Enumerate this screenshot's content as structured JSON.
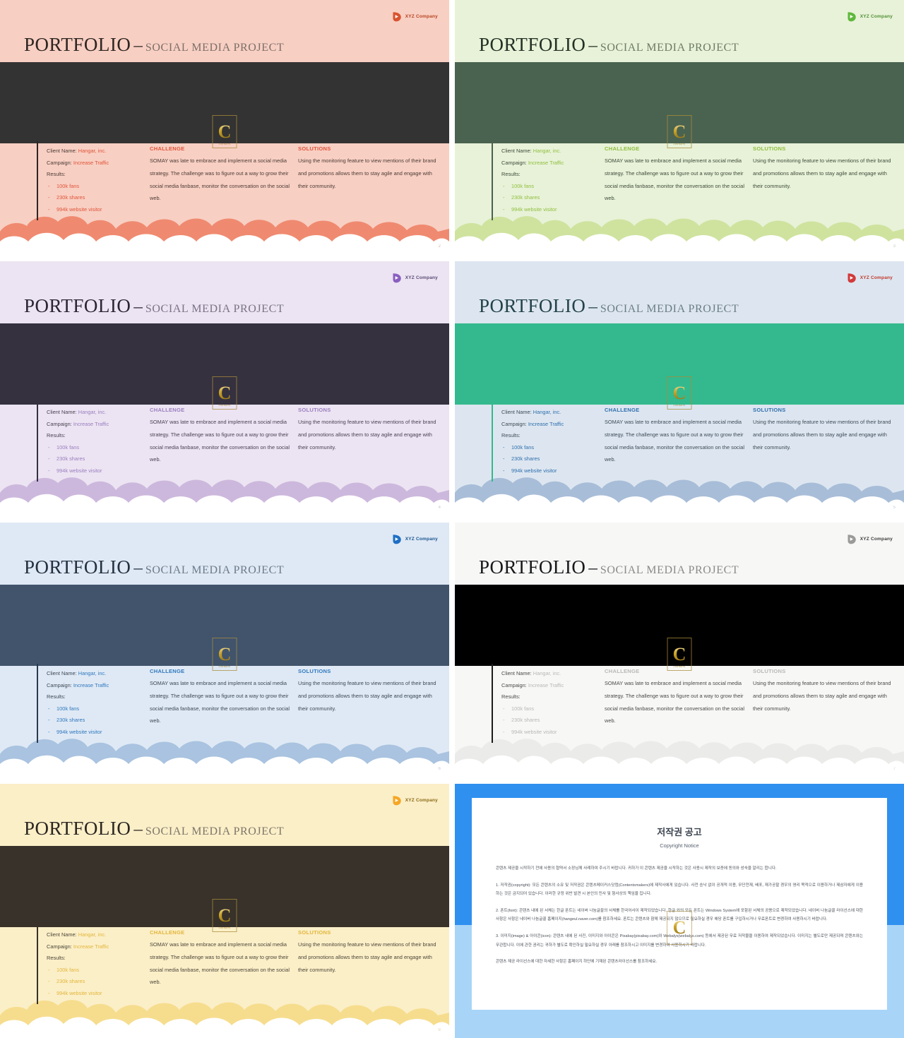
{
  "deck": {
    "title_main": "PORTFOLIO",
    "title_dash": "–",
    "title_sub": "SOCIAL MEDIA PROJECT",
    "logo_text": "XYZ Company",
    "emblem_letter": "C",
    "emblem_sub": "CONTENTS",
    "labels": {
      "client_label": "Client Name:",
      "client_value": "Hangar, inc.",
      "campaign_label": "Campaign:",
      "campaign_value": "Increase Traffic",
      "results_label": "Results:",
      "bullet_dash": "-",
      "result_1": "100k fans",
      "result_2": "230k shares",
      "result_3": "994k website visitor",
      "challenge_heading": "CHALLENGE",
      "challenge_body": "SOMAY was late to embrace and implement a social media strategy. The challenge was to figure out a way to grow their social media fanbase, monitor the conversation on the social web.",
      "solutions_heading": "SOLUTIONS",
      "solutions_body": "Using the monitoring feature to view mentions of their brand and promotions allows them to stay agile and engage with their community."
    }
  },
  "slides": [
    {
      "page": "2",
      "theme": "coral",
      "bg": "#f8cfc3",
      "band": "#333333",
      "title_color": "#2e2622",
      "sub_color": "#7d6f68",
      "logo_color": "#d8532f",
      "logo_text_color": "#b8431f",
      "accent": "#e0553a",
      "body_text": "#4b3b35",
      "bar": "#2e2622",
      "cloud_back": "#ef8a70",
      "cloud_front": "#ffffff",
      "pageno_color": "#c07a66"
    },
    {
      "page": "3",
      "theme": "green",
      "bg": "#e8f2d8",
      "band": "#4a6350",
      "title_color": "#243026",
      "sub_color": "#6f7a68",
      "logo_color": "#5fb83c",
      "logo_text_color": "#4f8f35",
      "accent": "#8fbf3f",
      "body_text": "#3e4a3c",
      "bar": "#4a6350",
      "cloud_back": "#cfe39f",
      "cloud_front": "#ffffff",
      "pageno_color": "#9aab84"
    },
    {
      "page": "4",
      "theme": "purple",
      "bg": "#ece4f2",
      "band": "#35313f",
      "title_color": "#2b2533",
      "sub_color": "#7a7385",
      "logo_color": "#8a5fc0",
      "logo_text_color": "#5b4a77",
      "accent": "#9a7ec0",
      "body_text": "#4a4255",
      "bar": "#35313f",
      "cloud_back": "#cdb8dd",
      "cloud_front": "#ffffff",
      "pageno_color": "#a294b0"
    },
    {
      "page": "5",
      "theme": "teal",
      "bg": "#dde6f0",
      "band": "#33b98d",
      "title_color": "#23424a",
      "sub_color": "#6b7d86",
      "logo_color": "#d23a3a",
      "logo_text_color": "#c0392b",
      "accent": "#2f6fae",
      "body_text": "#3d4a58",
      "bar": "#33b98d",
      "cloud_back": "#a8bdd8",
      "cloud_front": "#ffffff",
      "pageno_color": "#93a5bb"
    },
    {
      "page": "6",
      "theme": "blue",
      "bg": "#dfe9f5",
      "band": "#41546c",
      "title_color": "#23303f",
      "sub_color": "#6d7a89",
      "logo_color": "#1e6fc4",
      "logo_text_color": "#17538f",
      "accent": "#2f78bd",
      "body_text": "#3c4856",
      "bar": "#2b3b4e",
      "cloud_back": "#a9c3e0",
      "cloud_front": "#ffffff",
      "pageno_color": "#92a8c2"
    },
    {
      "page": "7",
      "theme": "mono",
      "bg": "#f7f7f6",
      "band": "#000000",
      "title_color": "#17181a",
      "sub_color": "#8a8a88",
      "logo_color": "#9a9a98",
      "logo_text_color": "#3b3b3b",
      "accent": "#b8b8b6",
      "body_text": "#4a4a48",
      "bar": "#1b1b1b",
      "cloud_back": "#ebebe9",
      "cloud_front": "#ffffff",
      "pageno_color": "#b0b0ae"
    },
    {
      "page": "8",
      "theme": "yellow",
      "bg": "#fbefc8",
      "band": "#38322a",
      "title_color": "#2b2620",
      "sub_color": "#7e7668",
      "logo_color": "#f5a623",
      "logo_text_color": "#8a6a14",
      "accent": "#e3b63a",
      "body_text": "#4c4538",
      "bar": "#38322a",
      "cloud_back": "#f6dd8e",
      "cloud_front": "#ffffff",
      "pageno_color": "#c9b27a"
    }
  ],
  "copyright": {
    "heading_ko": "저작권 공고",
    "heading_en": "Copyright Notice",
    "intro": "콘텐츠 제공을 시작하기 전에 사용의 협약서 소장님께 사례하여 주시기 바랍니다. 귀하가 이 콘텐츠 제공을 시작하는 것은 사용시 제작의 보증에 동의와 성숙을 알리는 합니다.",
    "item1": "1. 저작권(copyright): 모든 콘텐츠의 소유 및 저작권은 콘텐츠메이커스닷컴(Contentsmakers)에 제작사에게 있습니다. 사전 승낙 없이 공개적 이용, 무단전재, 배포, 재가공할 경우의 영리 목적으로 이용하거나 제삼자에게 이용하는 것은 금지되어 있습니다. 이러한 규정 위반 발견 시 본인의 민사 및 형사상의 책임을 집니다.",
    "item2": "2. 폰트(font): 콘텐츠 내에 된 서체는 한글 폰트는 네이버 나눔글꼴의 서체를 한국어사이 제작되었습니다. 한글 외의 모든 폰트는 Windows System에 포함된 서체의 공용으로 제작되었습니다. 네이버 나눔글꼴 라이선스에 대한 사항은 사항은 네이버 나눔글꼴 홈페이지(hangeul.naver.com)를 참조하세요. 폰트는 콘텐츠와 함께 제공되지 않으므로 필요하실 경우 해당 폰트를 구입하시거나 무료폰트로 변경하여 사용하시기 바랍니다.",
    "item3": "3. 이미지(image) & 아이콘(icon): 콘텐츠 내에 된 사진, 이미지와 아이콘은 Pixabay(pixabay.com)와 Webalys(webalys.com) 등에서 제공된 무료 저작물을 이용하여 제작되었습니다. 이미지는 별도로만 제공되며 콘텐츠와는 무관합니다. 이에 관한 권리는 귀하가 별도로 확인하실 필요하실 경우 아래를 참조하시고 이미지를 변경하여 사용하시기 바랍니다.",
    "footer": "콘텐츠 제공 라이선스에 대한 자세한 사항은 홈페이지 하단에 기재된 콘텐츠라이선스를 참조하세요.",
    "emblem_letter": "C",
    "frame_color": "#2f90ef",
    "frame_color_light": "#a8d5f7"
  }
}
